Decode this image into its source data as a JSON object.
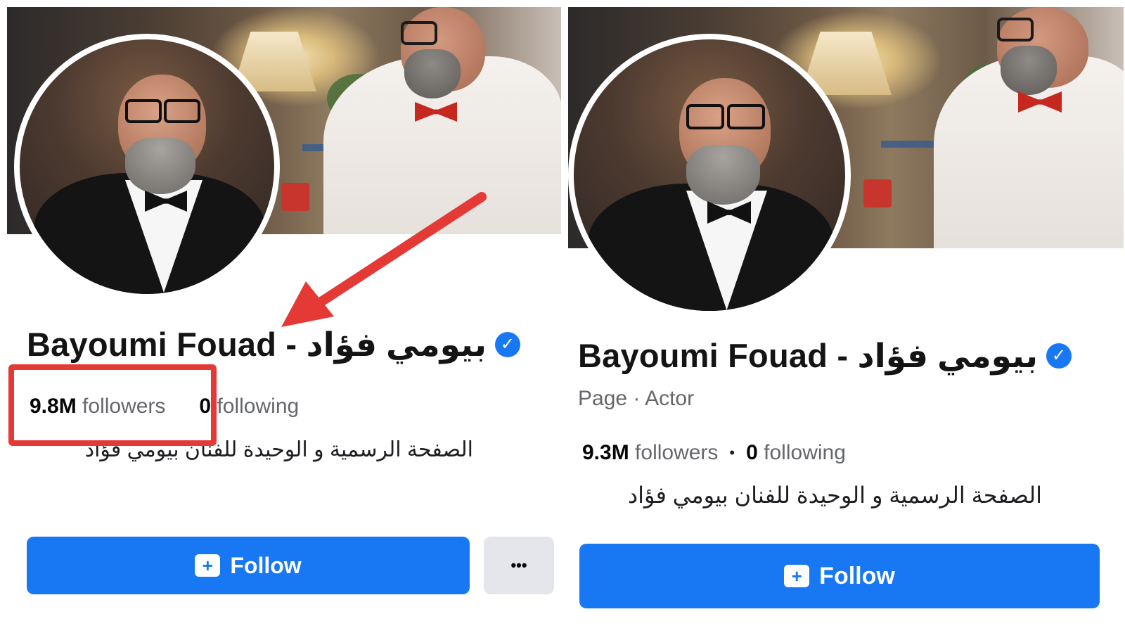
{
  "left": {
    "name": "Bayoumi Fouad - بيومي فؤاد",
    "verified_glyph": "✓",
    "followers_count": "9.8M",
    "followers_label": "followers",
    "following_count": "0",
    "following_label": "following",
    "bio": "الصفحة الرسمية و الوحيدة للفنان بيومي فؤاد",
    "follow_label": "Follow",
    "more_label": "•••"
  },
  "right": {
    "name": "Bayoumi Fouad - بيومي فؤاد",
    "verified_glyph": "✓",
    "category": "Page · Actor",
    "followers_count": "9.3M",
    "followers_label": "followers",
    "separator": "•",
    "following_count": "0",
    "following_label": "following",
    "bio": "الصفحة الرسمية و الوحيدة للفنان بيومي فؤاد",
    "follow_label": "Follow"
  },
  "colors": {
    "facebook_blue": "#1877f2",
    "annotation_red": "#e53935"
  },
  "icons": {
    "verified": "verified-badge-icon",
    "follow": "follow-add-icon",
    "more": "more-options-icon"
  }
}
